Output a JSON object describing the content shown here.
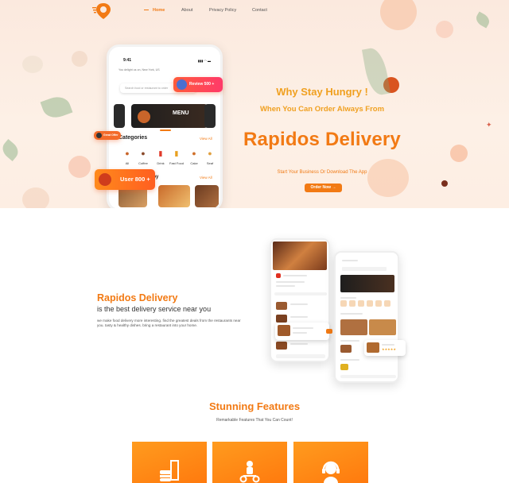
{
  "nav": {
    "items": [
      "Home",
      "About",
      "Privacy Policy",
      "Contact"
    ]
  },
  "hero": {
    "headline": "Why Stay Hungry !",
    "subheadline": "When You Can Order Always From",
    "brand": "Rapidos Delivery",
    "tagline": "Start Your Business Or Download The App",
    "cta_label": "Order Now →"
  },
  "phone": {
    "time": "9:41",
    "status": "▮▮▮ ◠ ▬",
    "location": "You delight us on, New York, US",
    "search_placeholder": "Search food or restaurant to order",
    "categories_title": "Categories",
    "view_all": "View All",
    "categories": [
      {
        "label": "All",
        "icon": "burger-icon"
      },
      {
        "label": "Coffee",
        "icon": "coffee-icon"
      },
      {
        "label": "Drink",
        "icon": "drink-icon"
      },
      {
        "label": "Fast Food",
        "icon": "fries-icon"
      },
      {
        "label": "Cake",
        "icon": "cake-icon"
      },
      {
        "label": "Seaf",
        "icon": "fish-icon"
      }
    ],
    "nearby_title": "Nearby"
  },
  "badges": {
    "review": "Review 500 +",
    "small": "Great Offer",
    "user": "User 800 +"
  },
  "about": {
    "brand": "Rapidos Delivery",
    "subtitle": "is the best delivery service near you",
    "description": "we make food delivery more interesting. find the greatest deals from the restaurants near you. tasty & healthy dishes. bring a restaurant into your home."
  },
  "features": {
    "title": "Stunning Features",
    "subtitle": "Remarkable Features That You Can Count!",
    "cards": [
      {
        "icon": "fastfood-icon"
      },
      {
        "icon": "scooter-delivery-icon"
      },
      {
        "icon": "support-agent-icon"
      }
    ]
  },
  "colors": {
    "brand_orange": "#f27a14",
    "headline_yellow": "#f0a020",
    "hero_bg": "#fbe9de",
    "review_pink": "#ff3a6a"
  }
}
